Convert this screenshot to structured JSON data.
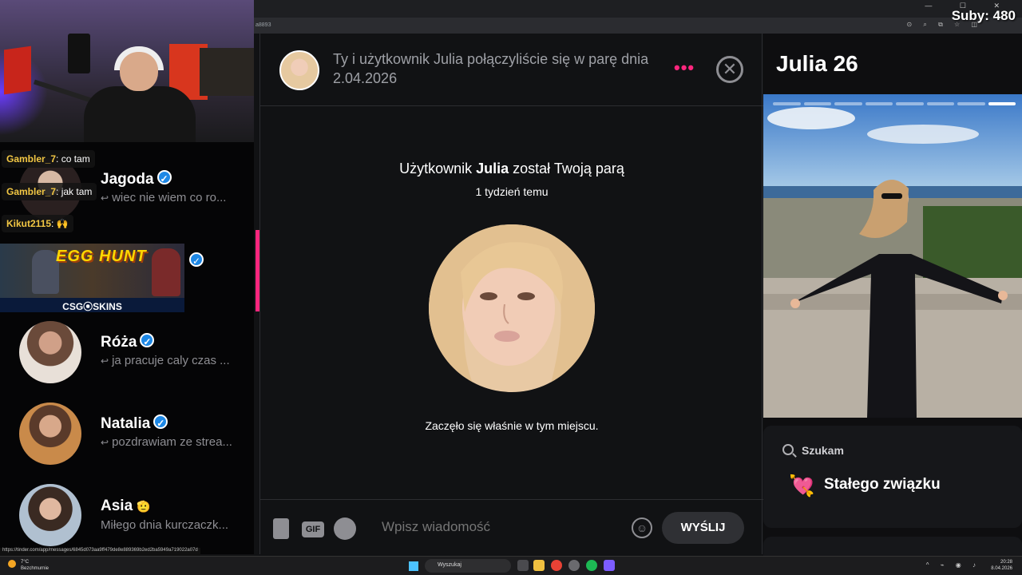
{
  "overlay": {
    "subs": "Suby: 480"
  },
  "browser": {
    "address": "a8893"
  },
  "stream_chat": [
    {
      "user": "Gambler_7",
      "text": ": co tam"
    },
    {
      "user": "Gambler_7",
      "text": ": jak tam"
    },
    {
      "user": "Kikut2115",
      "text": ": 🙌"
    }
  ],
  "matches": [
    {
      "name": "Jagoda",
      "last": "wiec nie wiem co ro..."
    },
    {
      "name": "Róża",
      "last": "ja pracuje caly czas ..."
    },
    {
      "name": "Natalia",
      "last": "pozdrawiam ze strea..."
    },
    {
      "name": "Asia",
      "badge": "🫡",
      "last": "Miłego dnia kurczaczk..."
    }
  ],
  "ad": {
    "title": "EGG HUNT",
    "strip": "CSG⦿SKINS"
  },
  "status_url": "https://tinder.com/app/messages/6845d073aa9ff479de8e889369b2ed2ba5949a719022a07d",
  "conversation": {
    "header_text": "Ty i użytkownik Julia połączyliście się w parę dnia 2.04.2026",
    "more_label": "•••",
    "close_label": "✕",
    "match_prefix": "Użytkownik ",
    "match_name": "Julia",
    "match_suffix": " został Twoją parą",
    "match_time": "1 tydzień temu",
    "caption": "Zaczęło się właśnie w tym miejscu."
  },
  "composer": {
    "gif_label": "GIF",
    "placeholder": "Wpisz wiadomość",
    "send_label": "WYŚLIJ",
    "emoji": "☺"
  },
  "profile": {
    "name_age": "Julia 26",
    "photo_count": 8,
    "active_photo": 7,
    "looking_label": "Szukam",
    "looking_value": "Stałego związku",
    "heart": "💘"
  },
  "taskbar": {
    "weather_temp": "7°C",
    "weather_desc": "Bezchmurnie",
    "search": "Wyszukaj",
    "time": "20:28",
    "date": "8.04.2026"
  }
}
